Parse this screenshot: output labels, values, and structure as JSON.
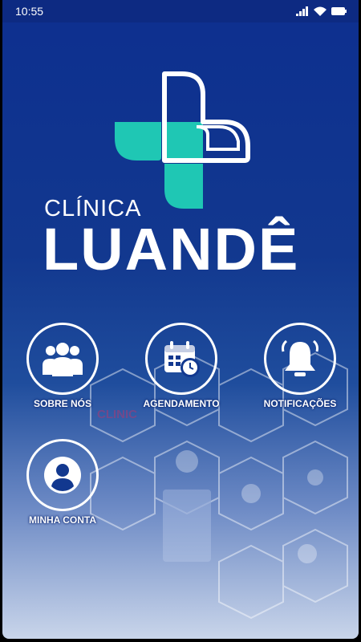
{
  "status_bar": {
    "time": "10:55"
  },
  "logo": {
    "line1": "CLÍNICA",
    "line2": "LUANDÊ"
  },
  "menu": [
    {
      "label": "SOBRE NÓS"
    },
    {
      "label": "AGENDAMENTO"
    },
    {
      "label": "NOTIFICAÇÕES"
    },
    {
      "label": "MINHA CONTA"
    }
  ],
  "colors": {
    "brand_blue": "#12388f",
    "accent_teal": "#1fc7b4"
  },
  "background_text": "CLINIC"
}
